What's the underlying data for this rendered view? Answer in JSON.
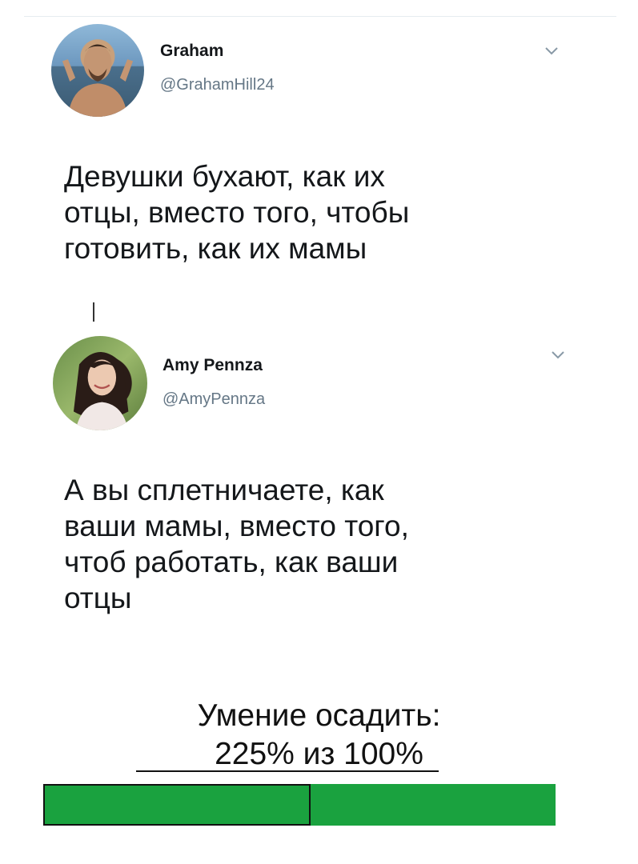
{
  "tweet1": {
    "name": "Graham",
    "handle": "@GrahamHill24",
    "text": "Девушки бухают, как их\nотцы, вместо того, чтобы\nготовить, как их мамы"
  },
  "tweet2": {
    "name": "Amy Pennza",
    "handle": "@AmyPennza",
    "text": "А вы сплетничаете, как\nваши мамы, вместо того,\nчтоб работать, как ваши\nотцы"
  },
  "meme": {
    "caption_line1": "Умение осадить:",
    "caption_line2": "225% из 100%",
    "progress_percent": 225,
    "progress_max_percent": 100,
    "bar_color": "#1aa23f"
  },
  "icons": {
    "menu_chevron": "chevron-down-icon"
  }
}
